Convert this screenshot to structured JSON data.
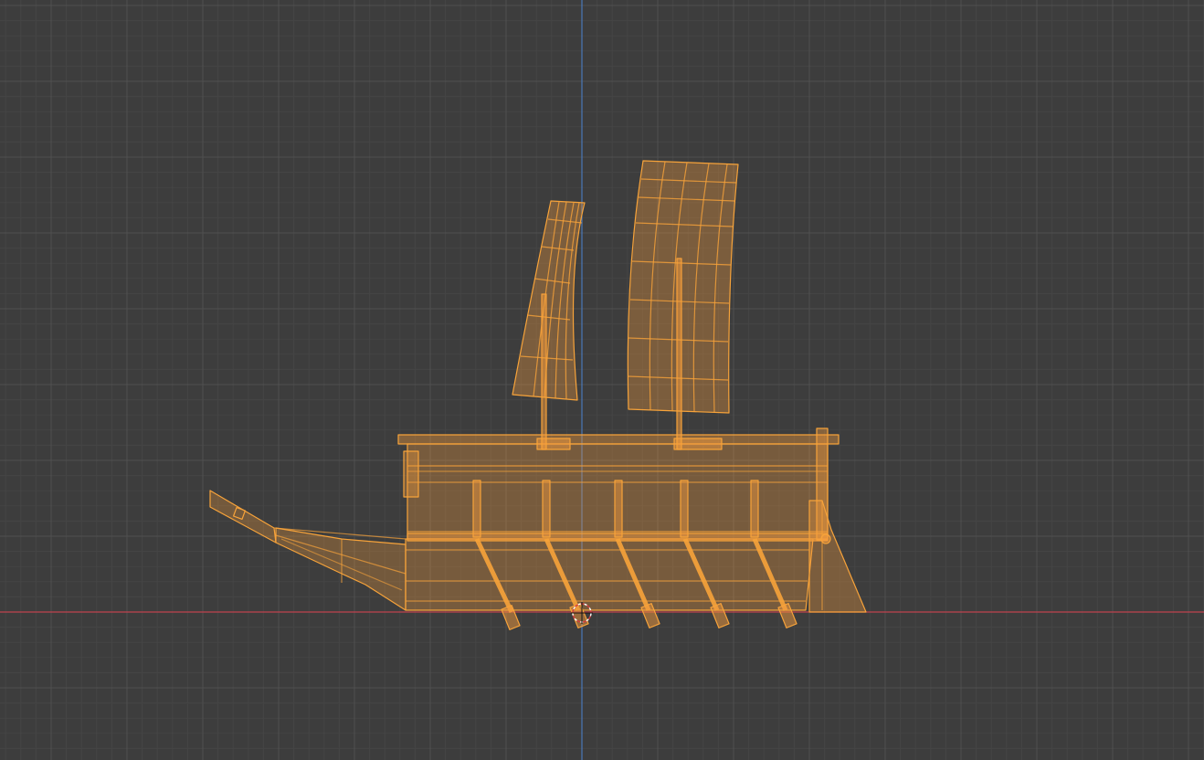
{
  "viewport": {
    "view": "orthographic-side",
    "mode": "object",
    "shading": "wireframe-xray"
  },
  "colors": {
    "background": "#3d3d3d",
    "grid_minor": "#454545",
    "grid_major": "#505050",
    "axis_x": "#c0424e",
    "axis_z": "#4a78b8",
    "selected_edge": "#f7a33a",
    "selected_fill": "#f29a3d"
  },
  "scene": {
    "selected_object": "ship",
    "parts": [
      "hull",
      "deck-cabin",
      "bow-prow",
      "stern-rudder",
      "front-sail",
      "main-sail",
      "front-mast",
      "main-mast",
      "oars"
    ],
    "oar_count": 5,
    "sail_count": 2
  }
}
